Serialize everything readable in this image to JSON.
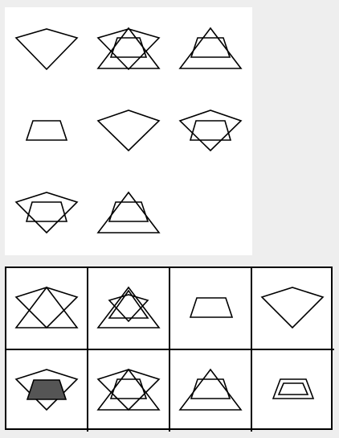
{
  "puzzle": {
    "rows": [
      [
        [
          "kite"
        ],
        [
          "kite",
          "trapezoid",
          "triangle"
        ],
        [
          "triangle",
          "trapezoid"
        ]
      ],
      [
        [
          "trapezoid"
        ],
        [
          "kite"
        ],
        [
          "kite",
          "hexagon"
        ]
      ],
      [
        [
          "kite",
          "hexagon"
        ],
        [
          "triangle",
          "trapezoid"
        ],
        []
      ]
    ]
  },
  "answers": {
    "options": [
      {
        "shapes": [
          "kite",
          "triangle",
          "triangle"
        ]
      },
      {
        "shapes": [
          "triangle",
          "kite",
          "triangle"
        ]
      },
      {
        "shapes": [
          "trapezoid"
        ]
      },
      {
        "shapes": [
          "kite"
        ]
      },
      {
        "shapes": [
          "kite",
          "trapezoid"
        ],
        "filled": "trapezoid"
      },
      {
        "shapes": [
          "kite",
          "trapezoid",
          "triangle"
        ]
      },
      {
        "shapes": [
          "triangle",
          "trapezoid"
        ]
      },
      {
        "shapes": [
          "trapezoid",
          "trapezoid"
        ]
      }
    ]
  },
  "colors": {
    "line": "#000000",
    "fill": "#555555",
    "page_bg": "#eeeeee",
    "panel_bg": "#ffffff"
  }
}
